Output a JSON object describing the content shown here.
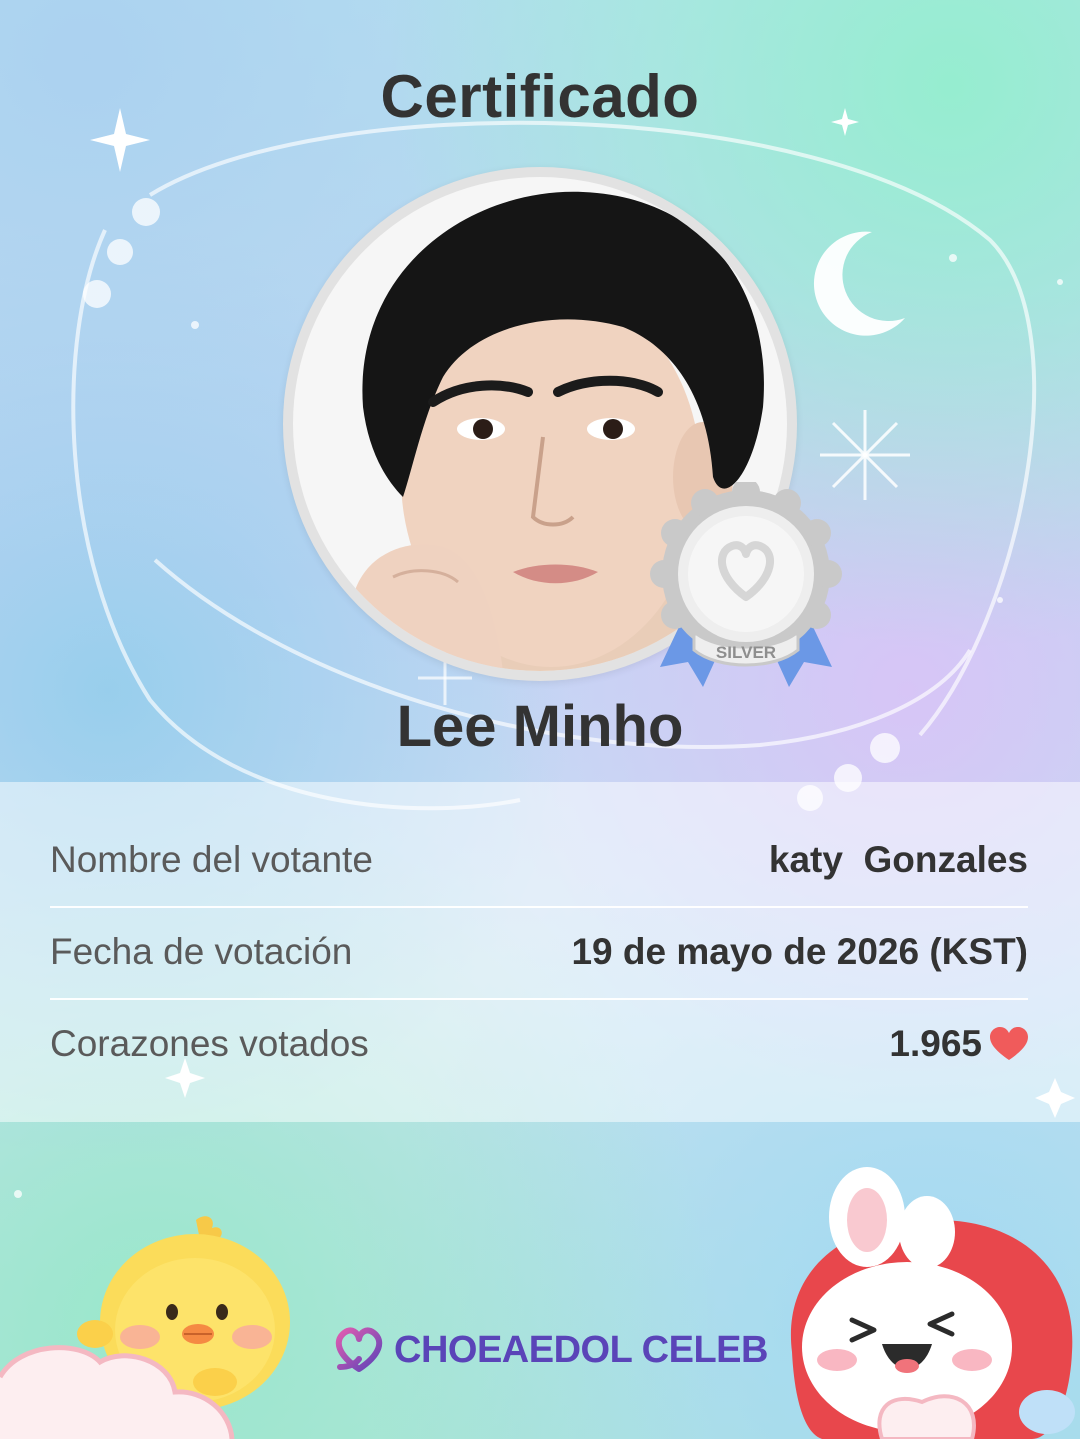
{
  "title": "Certificado",
  "celebrity": {
    "name": "Lee Minho",
    "portrait": "celebrity-portrait-photo",
    "medal": {
      "icon": "silver-medal-icon",
      "label": "SILVER"
    }
  },
  "info": {
    "rows": [
      {
        "label": "Nombre del votante",
        "value": "katy  Gonzales"
      },
      {
        "label": "Fecha de votación",
        "value": "19 de mayo de 2026 (KST)"
      },
      {
        "label": "Corazones votados",
        "value": "1.965",
        "icon": "heart-icon"
      }
    ]
  },
  "brand": {
    "name": "CHOEAEDOL CELEB",
    "icon": "choeaedol-heart-logo-icon"
  },
  "decorations": {
    "left_character": "chick-character",
    "right_character": "bunny-character",
    "moon": "crescent-moon-icon",
    "sparkles": "sparkle-icon"
  },
  "colors": {
    "heart": "#f05b5b",
    "brand": "#5a44b8",
    "medal_silver": "#c9c9c9",
    "ribbon": "#6b98e6"
  }
}
